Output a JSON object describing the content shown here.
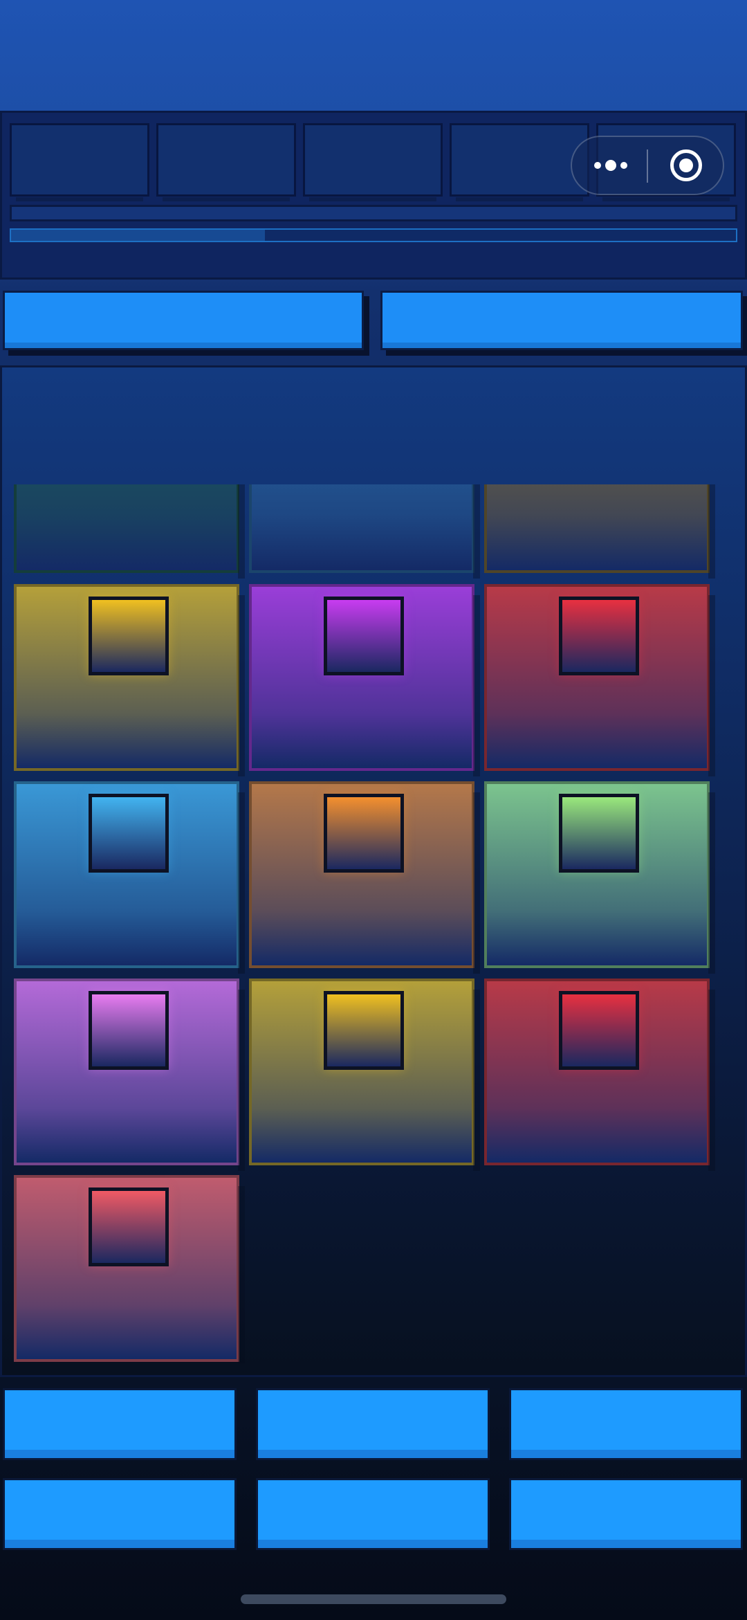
{
  "header": {
    "slots": [
      "",
      "",
      "",
      "",
      ""
    ],
    "progress": 0.35
  },
  "capsule": {
    "more_icon": "more-dots-icon",
    "target_icon": "record-target-icon"
  },
  "top_buttons": [
    {
      "label": ""
    },
    {
      "label": ""
    }
  ],
  "board": {
    "tiles": [
      {
        "color": "#1f5e5a",
        "gem": false,
        "partial": true
      },
      {
        "color": "#2a6aa6",
        "gem": false,
        "partial": true
      },
      {
        "color": "#7a6a3e",
        "gem": false,
        "partial": true
      },
      {
        "color": "#b5a03a",
        "gem": "#f0c020"
      },
      {
        "color": "#9a3ed8",
        "gem": "#c83cf0"
      },
      {
        "color": "#b83a48",
        "gem": "#e83040"
      },
      {
        "color": "#3a98d6",
        "gem": "#42b4f0"
      },
      {
        "color": "#b4784a",
        "gem": "#f4902e"
      },
      {
        "color": "#7cc48e",
        "gem": "#9ae87c"
      },
      {
        "color": "#b46ad8",
        "gem": "#e87cf0"
      },
      {
        "color": "#b4a03a",
        "gem": "#f0c020"
      },
      {
        "color": "#b83a48",
        "gem": "#e83040"
      },
      {
        "color": "#c05c6e",
        "gem": "#f05a64"
      }
    ]
  },
  "bottom_buttons": [
    {
      "label": ""
    },
    {
      "label": ""
    },
    {
      "label": ""
    },
    {
      "label": ""
    },
    {
      "label": ""
    },
    {
      "label": ""
    }
  ]
}
